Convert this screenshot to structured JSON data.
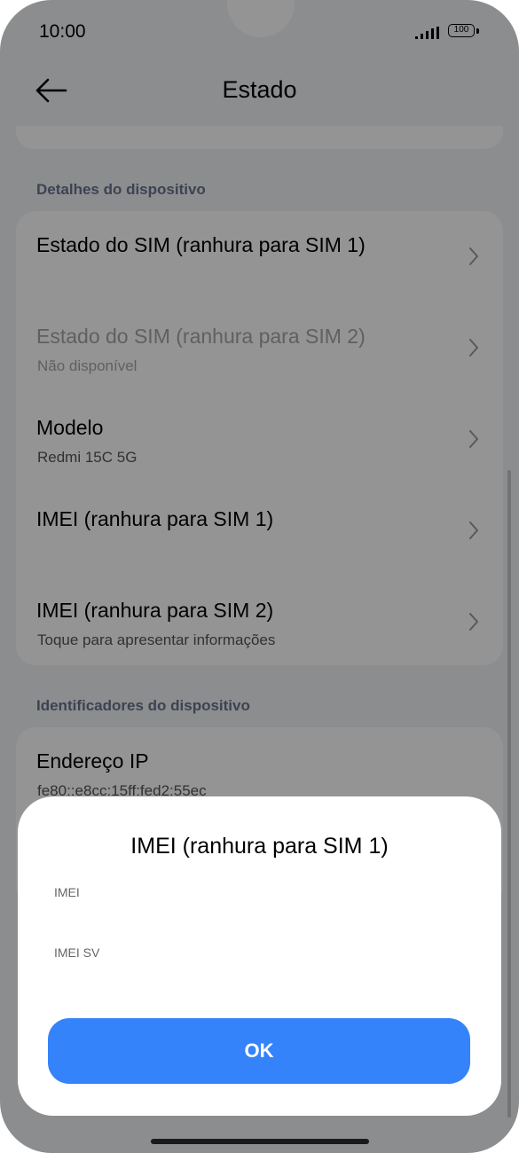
{
  "status_bar": {
    "time": "10:00",
    "battery": "100"
  },
  "header": {
    "title": "Estado"
  },
  "sections": {
    "details": {
      "label": "Detalhes do dispositivo",
      "rows": [
        {
          "title": "Estado do SIM (ranhura para SIM 1)",
          "subtitle": ""
        },
        {
          "title": "Estado do SIM (ranhura para SIM 2)",
          "subtitle": "Não disponível"
        },
        {
          "title": "Modelo",
          "subtitle": "Redmi 15C 5G"
        },
        {
          "title": "IMEI (ranhura para SIM 1)",
          "subtitle": ""
        },
        {
          "title": "IMEI (ranhura para SIM 2)",
          "subtitle": "Toque para apresentar informações"
        }
      ]
    },
    "identifiers": {
      "label": "Identificadores do dispositivo",
      "rows": [
        {
          "title": "Endereço IP",
          "subtitle": "fe80::e8cc:15ff:fed2:55ec"
        }
      ]
    }
  },
  "dialog": {
    "title": "IMEI (ranhura para SIM 1)",
    "imei_label": "IMEI",
    "imei_sv_label": "IMEI SV",
    "ok_label": "OK"
  },
  "colors": {
    "accent": "#3483fa",
    "section_label": "#6a7390",
    "background": "#f2f3f5"
  }
}
